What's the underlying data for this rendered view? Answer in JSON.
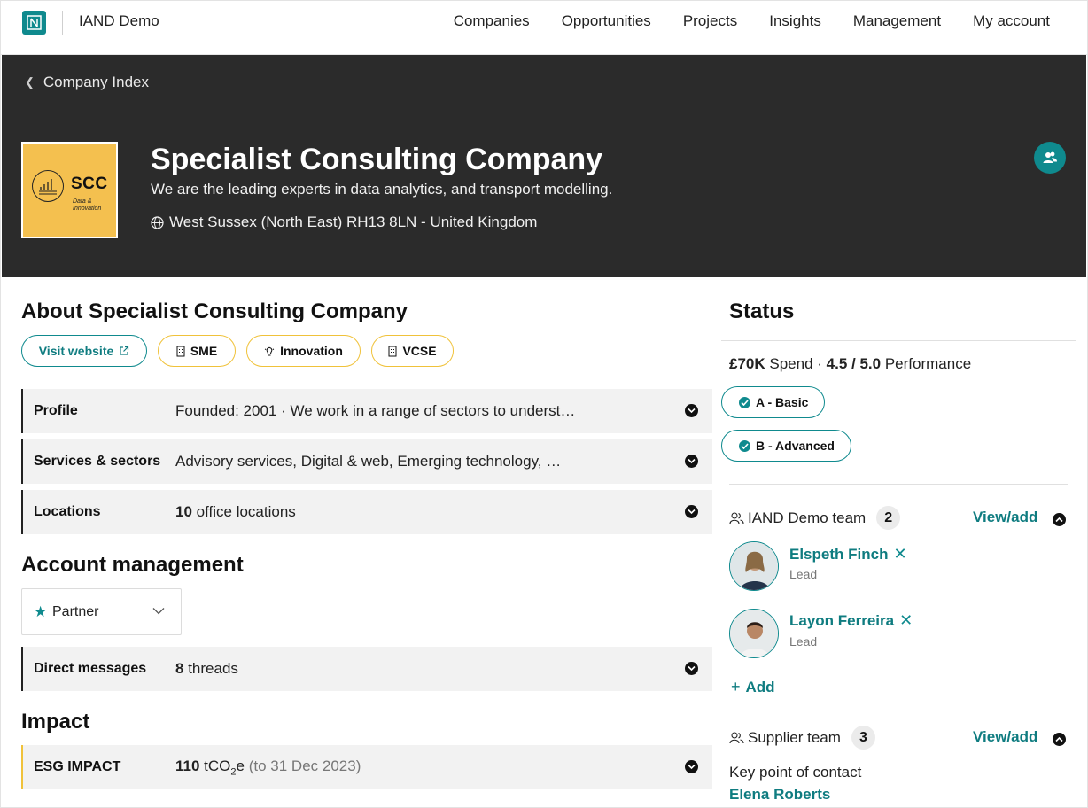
{
  "nav": {
    "brand": "IAND Demo",
    "links": [
      "Companies",
      "Opportunities",
      "Projects",
      "Insights",
      "Management",
      "My account"
    ]
  },
  "hero": {
    "breadcrumb": "Company Index",
    "logo_text": "SCC",
    "logo_sub": "Data & Innovation",
    "title": "Specialist Consulting Company",
    "tagline": "We are the leading experts in data analytics, and transport modelling.",
    "location": "West Sussex (North East) RH13 8LN - United Kingdom"
  },
  "about": {
    "heading": "About Specialist Consulting Company",
    "pills": {
      "website": "Visit website",
      "sme": "SME",
      "innovation": "Innovation",
      "vcse": "VCSE"
    },
    "rows": [
      {
        "label": "Profile",
        "value": "Founded: 2001 · We work in a range of sectors to underst…"
      },
      {
        "label": "Services & sectors",
        "value": "Advisory services, Digital & web, Emerging technology, …"
      },
      {
        "label": "Locations",
        "value_bold": "10",
        "value": "office locations"
      }
    ]
  },
  "account": {
    "heading": "Account management",
    "select_value": "Partner",
    "messages_label": "Direct messages",
    "messages_count": "8",
    "messages_unit": "threads"
  },
  "impact": {
    "heading": "Impact",
    "label": "ESG IMPACT",
    "value": "110",
    "unit_prefix": "tCO",
    "unit_sub": "2",
    "unit_suffix": "e",
    "date_note": "(to 31 Dec 2023)"
  },
  "status": {
    "heading": "Status",
    "spend_value": "£70K",
    "spend_label": "Spend ·",
    "perf_value": "4.5 / 5.0",
    "perf_label": "Performance",
    "certs": [
      "A - Basic",
      "B - Advanced"
    ]
  },
  "iand_team": {
    "title": "IAND Demo team",
    "count": "2",
    "view_add": "View/add",
    "members": [
      {
        "name": "Elspeth Finch",
        "role": "Lead"
      },
      {
        "name": "Layon Ferreira",
        "role": "Lead"
      }
    ],
    "add": "Add"
  },
  "supplier_team": {
    "title": "Supplier team",
    "count": "3",
    "view_add": "View/add",
    "contact_label": "Key point of contact",
    "contact_name": "Elena Roberts"
  },
  "colors": {
    "accent": "#0f8a8e",
    "hero_bg": "#2b2b2b",
    "yellow": "#f0c23a",
    "logo_bg": "#f4c04f"
  }
}
